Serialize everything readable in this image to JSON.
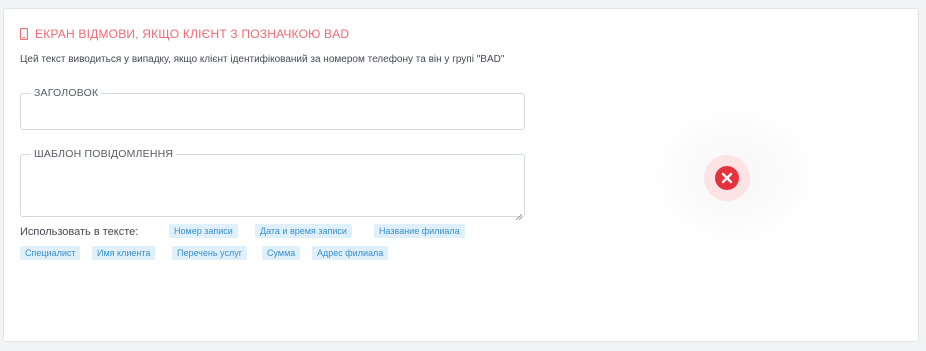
{
  "header": {
    "title": "ЕКРАН ВІДМОВИ, ЯКЩО КЛІЄНТ З ПОЗНАЧКОЮ BAD",
    "icon": "mobile-phone-icon",
    "color": "#f06a74"
  },
  "description": "Цей текст виводиться у випадку, якщо клієнт ідентифікований за номером телефону та він у групі \"BAD\"",
  "fields": {
    "title_label": "ЗАГОЛОВОК",
    "title_value": "",
    "template_label": "ШАБЛОН ПОВІДОМЛЕННЯ",
    "template_value": ""
  },
  "use_in_text": {
    "label": "Использовать в тексте:",
    "tags": [
      "Номер записи",
      "Дата и время записи",
      "Название филиала",
      "Специалист",
      "Имя клиента",
      "Перечень услуг",
      "Сумма",
      "Адрес филиала"
    ]
  },
  "status": {
    "icon": "error-x-icon",
    "color": "#e5323d"
  }
}
